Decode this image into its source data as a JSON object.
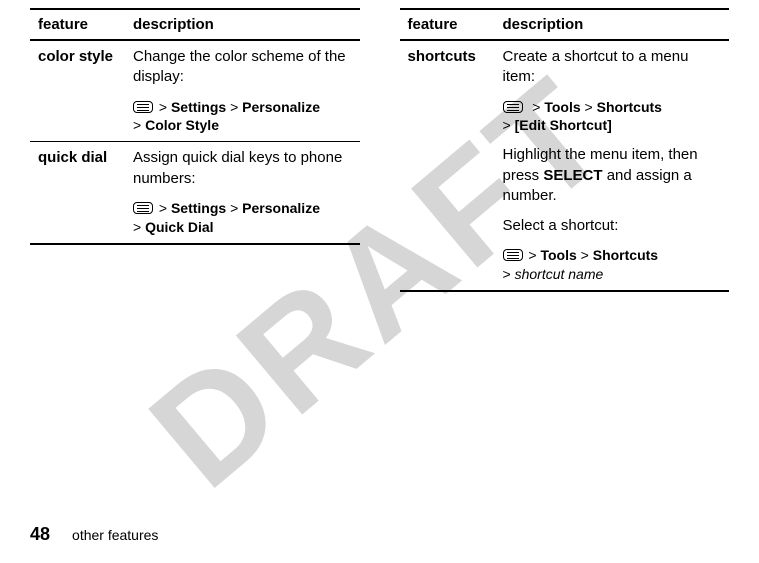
{
  "watermark": "DRAFT",
  "headers": {
    "feature": "feature",
    "description": "description"
  },
  "left_table": [
    {
      "feature": "color style",
      "desc": "Change the color scheme of the display:",
      "path_parts": [
        "Settings",
        "Personalize",
        "Color Style"
      ]
    },
    {
      "feature": "quick dial",
      "desc": "Assign quick dial keys to phone numbers:",
      "path_parts": [
        "Settings",
        "Personalize",
        "Quick Dial"
      ]
    }
  ],
  "right_table": {
    "feature": "shortcuts",
    "desc1": "Create a shortcut to a menu item:",
    "path1_parts": [
      "Tools",
      "Shortcuts",
      "[Edit Shortcut]"
    ],
    "desc2_pre": "Highlight the menu item, then press ",
    "select_label": "SELECT",
    "desc2_post": " and assign a number.",
    "desc3": "Select a shortcut:",
    "path2_parts": [
      "Tools",
      "Shortcuts"
    ],
    "path2_last_italic": "shortcut name"
  },
  "footer": {
    "page": "48",
    "section": "other features"
  }
}
